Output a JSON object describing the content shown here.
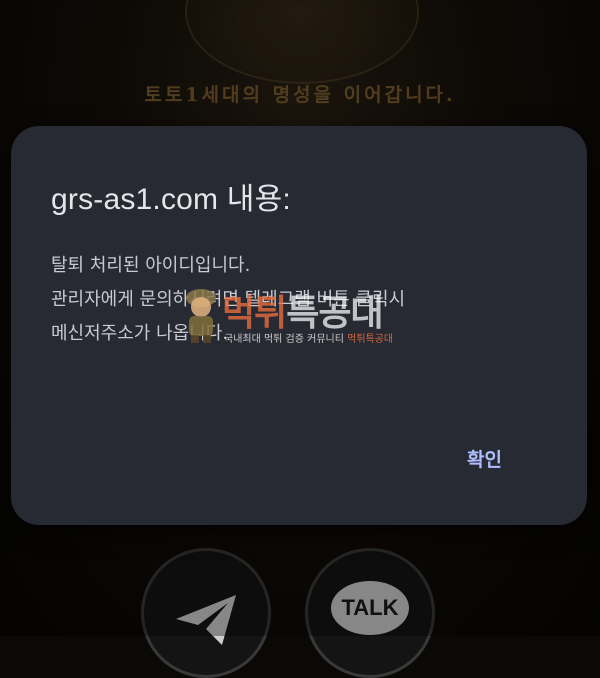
{
  "background": {
    "tagline": "토토1세대의 명성을 이어갑니다.",
    "buttons": [
      {
        "name": "telegram",
        "icon": "paper-plane-icon"
      },
      {
        "name": "kakaotalk",
        "label": "TALK"
      }
    ]
  },
  "dialog": {
    "title": "grs-as1.com 내용:",
    "message_lines": [
      "탈퇴 처리된 아이디입니다.",
      "관리자에게 문의하시려면 텔레그램 버튼 클릭시",
      "메신저주소가 나옵니다."
    ],
    "confirm_label": "확인"
  },
  "watermark": {
    "title_part1": "먹튀",
    "title_part2": "특공대",
    "subtitle_part1": "국내최대 먹튀 검증 커뮤니티 ",
    "subtitle_part2": "먹튀특공대"
  },
  "colors": {
    "dialog_bg": "#272a32",
    "accent": "#aebfff",
    "tagline": "#7d5f2e"
  }
}
